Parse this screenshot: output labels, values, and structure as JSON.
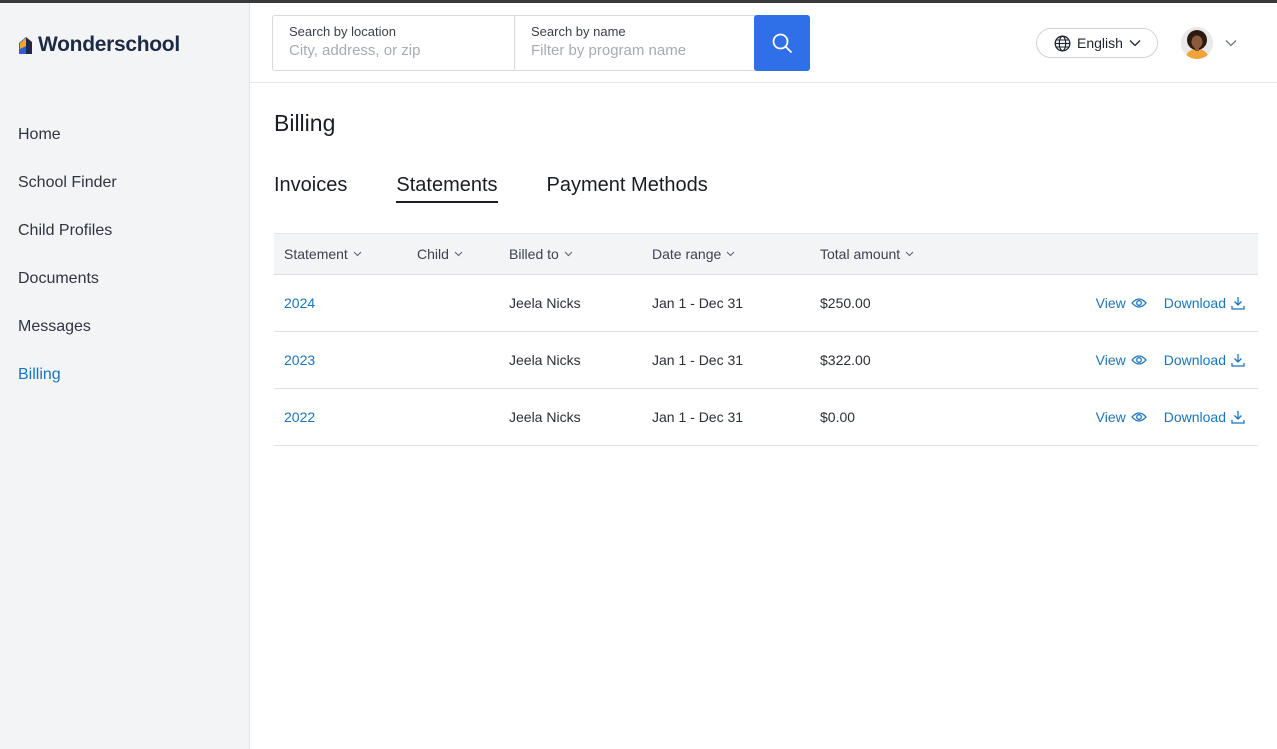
{
  "brand": {
    "name": "Wonderschool"
  },
  "sidebar": {
    "items": [
      {
        "label": "Home"
      },
      {
        "label": "School Finder"
      },
      {
        "label": "Child Profiles"
      },
      {
        "label": "Documents"
      },
      {
        "label": "Messages"
      },
      {
        "label": "Billing",
        "active": true
      }
    ]
  },
  "search": {
    "location_label": "Search by location",
    "location_placeholder": "City, address, or zip",
    "name_label": "Search by name",
    "name_placeholder": "Filter by program name"
  },
  "language": {
    "selected": "English"
  },
  "page": {
    "title": "Billing"
  },
  "tabs": [
    {
      "label": "Invoices"
    },
    {
      "label": "Statements",
      "active": true
    },
    {
      "label": "Payment Methods"
    }
  ],
  "table": {
    "columns": [
      "Statement",
      "Child",
      "Billed to",
      "Date range",
      "Total amount"
    ],
    "rows": [
      {
        "statement": "2024",
        "child": "",
        "billed_to": "Jeela Nicks",
        "date_range": "Jan 1 - Dec 31",
        "total": "$250.00"
      },
      {
        "statement": "2023",
        "child": "",
        "billed_to": "Jeela Nicks",
        "date_range": "Jan 1 - Dec 31",
        "total": "$322.00"
      },
      {
        "statement": "2022",
        "child": "",
        "billed_to": "Jeela Nicks",
        "date_range": "Jan 1 - Dec 31",
        "total": "$0.00"
      }
    ],
    "view_label": "View",
    "download_label": "Download"
  },
  "colors": {
    "accent": "#1b75bc",
    "search_button": "#2f6fe8",
    "sidebar_bg": "#f3f4f6"
  }
}
